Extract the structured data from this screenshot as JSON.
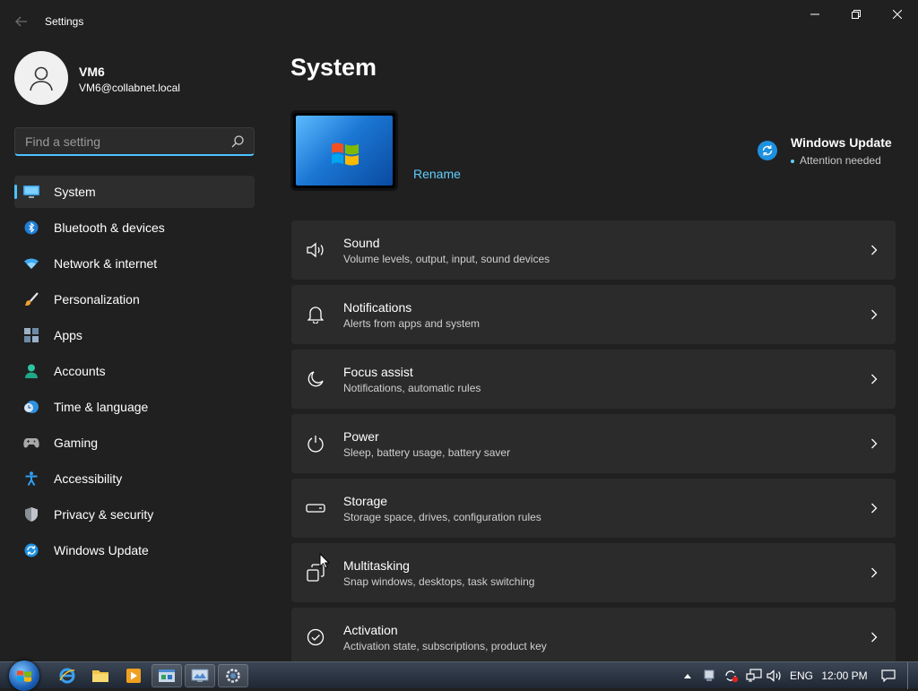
{
  "window": {
    "title": "Settings",
    "icons": {
      "back": "back-arrow-icon",
      "minimize": "minimize-icon",
      "maximize": "restore-icon",
      "close": "close-icon"
    }
  },
  "user": {
    "name": "VM6",
    "email": "VM6@collabnet.local",
    "avatar_icon": "user-avatar-icon"
  },
  "search": {
    "value": "",
    "placeholder": "Find a setting",
    "icon": "search-icon"
  },
  "sidebar": {
    "items": [
      {
        "label": "System",
        "icon": "monitor-icon",
        "active": true
      },
      {
        "label": "Bluetooth & devices",
        "icon": "bluetooth-icon"
      },
      {
        "label": "Network & internet",
        "icon": "wifi-icon"
      },
      {
        "label": "Personalization",
        "icon": "brush-icon"
      },
      {
        "label": "Apps",
        "icon": "apps-icon"
      },
      {
        "label": "Accounts",
        "icon": "person-icon"
      },
      {
        "label": "Time & language",
        "icon": "clock-globe-icon"
      },
      {
        "label": "Gaming",
        "icon": "gamepad-icon"
      },
      {
        "label": "Accessibility",
        "icon": "accessibility-icon"
      },
      {
        "label": "Privacy & security",
        "icon": "shield-icon"
      },
      {
        "label": "Windows Update",
        "icon": "windows-update-icon"
      }
    ]
  },
  "main": {
    "title": "System",
    "device": {
      "rename_label": "Rename"
    },
    "windows_update": {
      "title": "Windows Update",
      "status": "Attention needed"
    },
    "cards": [
      {
        "title": "Sound",
        "subtitle": "Volume levels, output, input, sound devices",
        "icon": "speaker-icon"
      },
      {
        "title": "Notifications",
        "subtitle": "Alerts from apps and system",
        "icon": "bell-icon"
      },
      {
        "title": "Focus assist",
        "subtitle": "Notifications, automatic rules",
        "icon": "moon-icon"
      },
      {
        "title": "Power",
        "subtitle": "Sleep, battery usage, battery saver",
        "icon": "power-icon"
      },
      {
        "title": "Storage",
        "subtitle": "Storage space, drives, configuration rules",
        "icon": "drive-icon"
      },
      {
        "title": "Multitasking",
        "subtitle": "Snap windows, desktops, task switching",
        "icon": "multitasking-icon"
      },
      {
        "title": "Activation",
        "subtitle": "Activation state, subscriptions, product key",
        "icon": "check-circle-icon"
      }
    ]
  },
  "taskbar": {
    "apps": [
      "internet-explorer-icon",
      "file-explorer-icon",
      "media-player-icon",
      "app-window-icon",
      "remote-desktop-icon",
      "settings-app-icon"
    ],
    "tray": {
      "language": "ENG",
      "time": "12:00 PM"
    }
  },
  "colors": {
    "background": "#202020",
    "card": "#2b2b2b",
    "accent": "#4cc2ff",
    "link": "#60cdff"
  }
}
